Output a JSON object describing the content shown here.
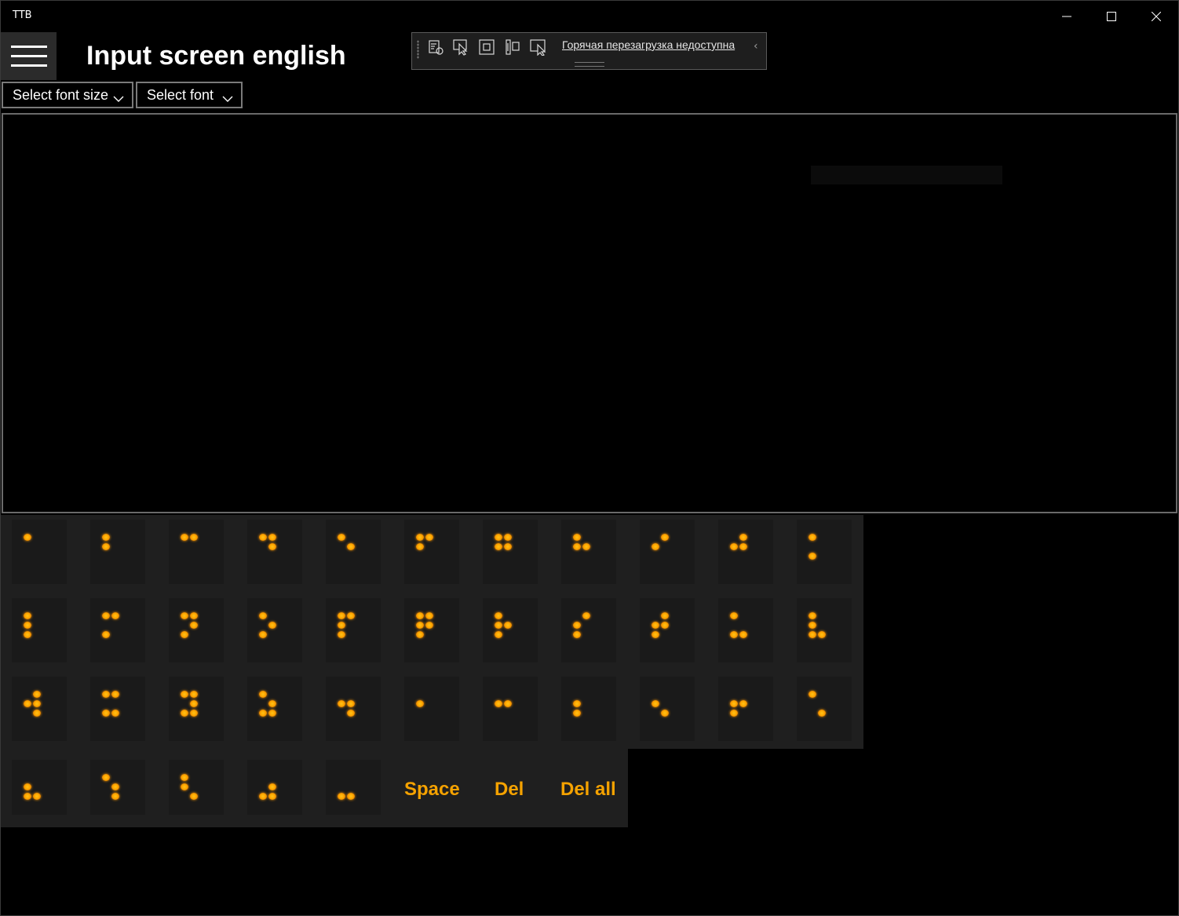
{
  "window": {
    "title": "TTB"
  },
  "header": {
    "title": "Input screen english"
  },
  "toolbar": {
    "hot_reload_text": "Горячая перезагрузка недоступна"
  },
  "controls": {
    "font_size_label": "Select font size",
    "font_label": "Select font"
  },
  "text_area": {
    "value": ""
  },
  "keyboard": {
    "special_keys": {
      "space": "Space",
      "del": "Del",
      "del_all": "Del all"
    },
    "braille_keys": [
      [
        1
      ],
      [
        1,
        2
      ],
      [
        1,
        4
      ],
      [
        1,
        4,
        5
      ],
      [
        1,
        5
      ],
      [
        1,
        2,
        4
      ],
      [
        1,
        2,
        4,
        5
      ],
      [
        1,
        2,
        5
      ],
      [
        2,
        4
      ],
      [
        2,
        4,
        5
      ],
      [
        1,
        3
      ],
      [
        1,
        2,
        3
      ],
      [
        1,
        3,
        4
      ],
      [
        1,
        3,
        4,
        5
      ],
      [
        1,
        3,
        5
      ],
      [
        1,
        2,
        3,
        4
      ],
      [
        1,
        2,
        3,
        4,
        5
      ],
      [
        1,
        2,
        3,
        5
      ],
      [
        2,
        3,
        4
      ],
      [
        2,
        3,
        4,
        5
      ],
      [
        1,
        3,
        6
      ],
      [
        1,
        2,
        3,
        6
      ],
      [
        2,
        4,
        5,
        6
      ],
      [
        1,
        3,
        4,
        6
      ],
      [
        1,
        3,
        4,
        5,
        6
      ],
      [
        1,
        3,
        5,
        6
      ],
      [
        2,
        5,
        6
      ],
      [
        2
      ],
      [
        2,
        5
      ],
      [
        2,
        3
      ],
      [
        2,
        6
      ],
      [
        2,
        5,
        3
      ],
      [
        1,
        6
      ],
      [
        2,
        3,
        6
      ],
      [
        1,
        5,
        6
      ],
      [
        1,
        2,
        6
      ],
      [
        3,
        5,
        6
      ],
      [
        3,
        6
      ]
    ]
  }
}
